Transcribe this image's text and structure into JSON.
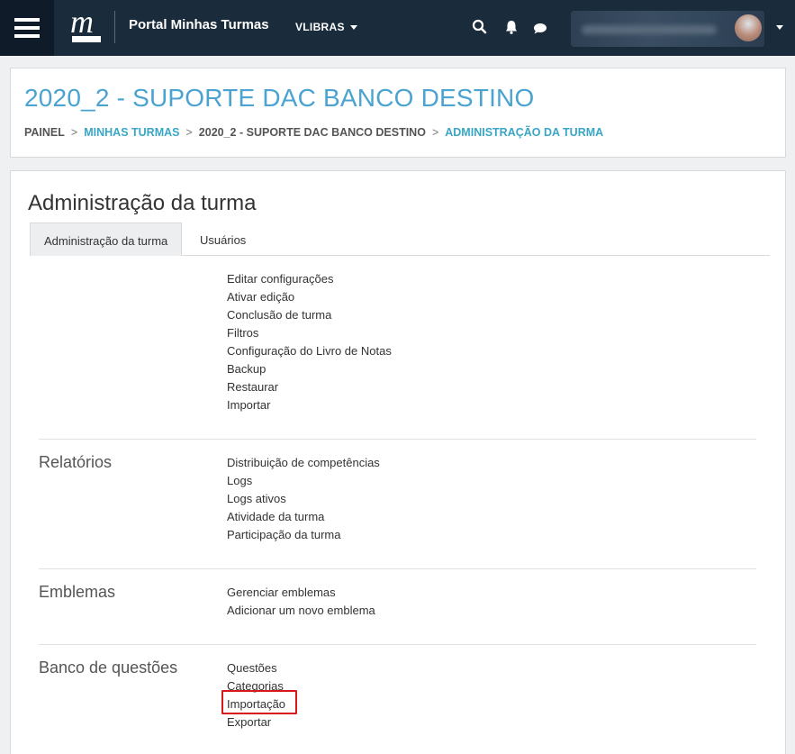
{
  "navbar": {
    "brand_letter": "m",
    "brand_title": "Portal Minhas Turmas",
    "lang_menu": "VLIBRAS"
  },
  "header": {
    "course_title": "2020_2 - SUPORTE DAC BANCO DESTINO",
    "breadcrumb": [
      {
        "label": "PAINEL"
      },
      {
        "label": "MINHAS TURMAS"
      },
      {
        "label": "2020_2 - SUPORTE DAC BANCO DESTINO"
      },
      {
        "label": "ADMINISTRAÇÃO DA TURMA"
      }
    ],
    "breadcrumb_sep": ">"
  },
  "main": {
    "page_title": "Administração da turma",
    "tabs": [
      {
        "label": "Administração da turma"
      },
      {
        "label": "Usuários"
      }
    ],
    "sections": [
      {
        "name": "",
        "links": [
          "Editar configurações",
          "Ativar edição",
          "Conclusão de turma",
          "Filtros",
          "Configuração do Livro de Notas",
          "Backup",
          "Restaurar",
          "Importar"
        ]
      },
      {
        "name": "Relatórios",
        "links": [
          "Distribuição de competências",
          "Logs",
          "Logs ativos",
          "Atividade da turma",
          "Participação da turma"
        ]
      },
      {
        "name": "Emblemas",
        "links": [
          "Gerenciar emblemas",
          "Adicionar um novo emblema"
        ]
      },
      {
        "name": "Banco de questões",
        "links": [
          "Questões",
          "Categorias",
          "Importação",
          "Exportar"
        ]
      }
    ]
  },
  "colors": {
    "navbar_bg": "#1a2b3c",
    "link_accent": "#3aa6c6",
    "title_accent": "#4aa3d0",
    "highlight": "#d9181e"
  }
}
